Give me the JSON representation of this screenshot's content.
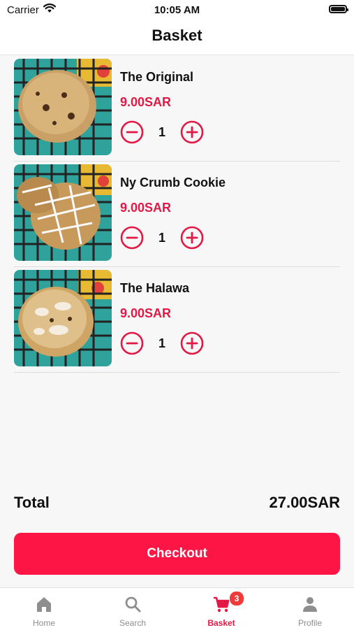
{
  "status_bar": {
    "carrier": "Carrier",
    "time": "10:05 AM"
  },
  "header": {
    "title": "Basket"
  },
  "items": [
    {
      "name": "The Original",
      "price": "9.00SAR",
      "quantity": "1",
      "image": "chocolate-chip-cookie"
    },
    {
      "name": "Ny Crumb Cookie",
      "price": "9.00SAR",
      "quantity": "1",
      "image": "white-drizzle-cookie"
    },
    {
      "name": "The Halawa",
      "price": "9.00SAR",
      "quantity": "1",
      "image": "halawa-cookie"
    }
  ],
  "summary": {
    "total_label": "Total",
    "total_value": "27.00SAR"
  },
  "checkout": {
    "label": "Checkout"
  },
  "tabbar": {
    "tabs": [
      {
        "label": "Home",
        "icon": "home-icon"
      },
      {
        "label": "Search",
        "icon": "search-icon"
      },
      {
        "label": "Basket",
        "icon": "cart-icon",
        "badge": "3",
        "active": true
      },
      {
        "label": "Profile",
        "icon": "person-icon"
      }
    ]
  },
  "colors": {
    "accent": "#e31845",
    "button": "#fd1545",
    "badge": "#f23a3a"
  }
}
